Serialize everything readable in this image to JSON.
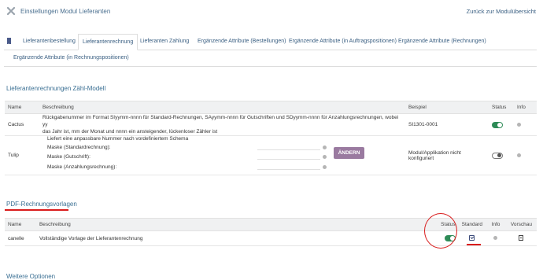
{
  "header": {
    "title": "Einstellungen Modul Lieferanten",
    "back_link": "Zurück zur Modulübersicht"
  },
  "tabs": [
    {
      "label": "Lieferantenbestellung"
    },
    {
      "label": "Lieferantenrechnung"
    },
    {
      "label": "Lieferanten Zahlung"
    },
    {
      "label": "Ergänzende Attribute (Bestellungen)"
    },
    {
      "label": "Ergänzende Attribute (in Auftragspositionen)"
    },
    {
      "label": "Ergänzende Attribute (Rechnungen)"
    },
    {
      "label": "Ergänzende Attribute (in Rechnungspositionen)"
    }
  ],
  "numbering": {
    "section_title": "Lieferantenrechnungen Zähl-Modell",
    "columns": {
      "name": "Name",
      "description": "Beschreibung",
      "example": "Beispiel",
      "status": "Status",
      "info": "Info"
    },
    "rows": [
      {
        "name": "Cactus",
        "description_line1": "Rückgabenummer im Format SIyymm-nnnn für Standard-Rechnungen, SAyymm-nnnn für Gutschriften und SDyymm-nnnn für Anzahlungsrechnungen, wobei yy",
        "description_line2": "das Jahr ist, mm der Monat und nnnn ein ansteigender, lückenloser Zähler ist",
        "example": "SI1301-0001",
        "status": "on"
      },
      {
        "name": "Tulip",
        "description": "Liefert eine anpassbare Nummer nach vordefiniertem Schema",
        "mask_standard": "Maske (Standardrechnung):",
        "mask_credit": "Maske (Gutschrift):",
        "mask_deposit": "Maske (Anzahlungsrechnung):",
        "button": "ÄNDERN",
        "example": "Modul/Applikation nicht konfiguriert",
        "status": "off"
      }
    ]
  },
  "pdf": {
    "section_title": "PDF-Rechnungsvorlagen",
    "columns": {
      "name": "Name",
      "description": "Beschreibung",
      "status": "Status",
      "default": "Standard",
      "info": "Info",
      "preview": "Vorschau"
    },
    "rows": [
      {
        "name": "canelle",
        "description": "Vollständige Vorlage der Lieferantenrechnung",
        "status": "on",
        "default": true
      }
    ]
  },
  "more_options": {
    "section_title": "Weitere Optionen"
  },
  "colors": {
    "accent": "#3a5f82",
    "toggle_on": "#2e8b57",
    "button": "#9a7aa0",
    "annotation": "#d91c1c"
  }
}
